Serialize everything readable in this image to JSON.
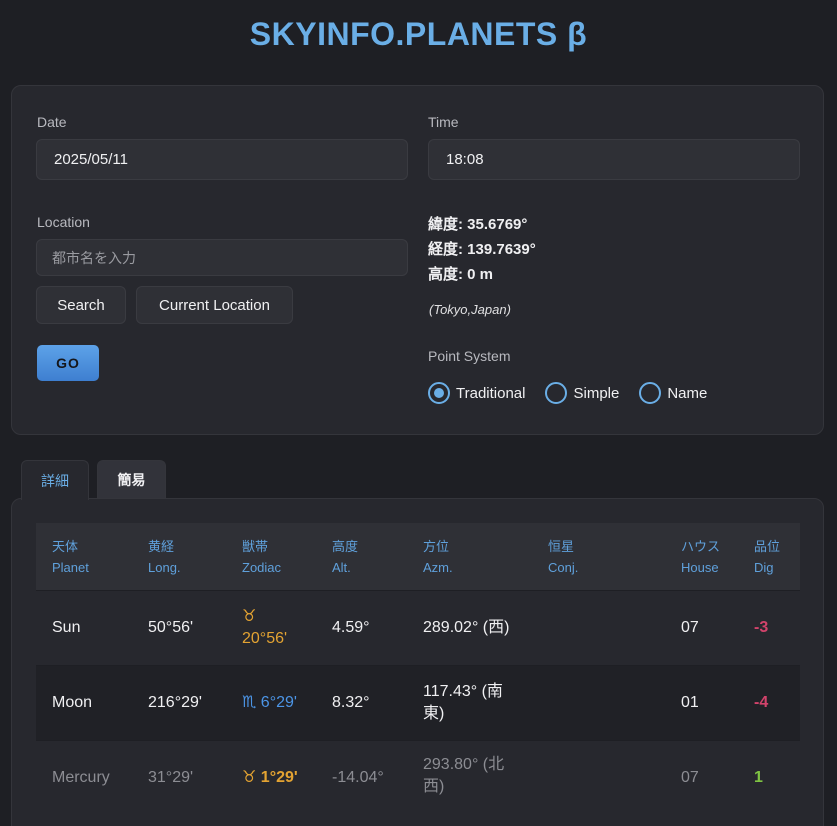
{
  "app": {
    "title": "SKYINFO.PLANETS β"
  },
  "form": {
    "date_label": "Date",
    "date_value": "2025/05/11",
    "time_label": "Time",
    "time_value": "18:08",
    "location_label": "Location",
    "location_placeholder": "都市名を入力",
    "search_label": "Search",
    "current_location_label": "Current Location",
    "go_label": "GO",
    "latitude": "緯度: 35.6769°",
    "longitude": "経度: 139.7639°",
    "altitude": "高度: 0 m",
    "place": "(Tokyo,Japan)",
    "point_system_label": "Point System",
    "point_system_options": [
      "Traditional",
      "Simple",
      "Name"
    ],
    "point_system_selected": "Traditional"
  },
  "tabs": [
    {
      "label": "詳細",
      "active": true
    },
    {
      "label": "簡易",
      "active": false
    }
  ],
  "table": {
    "headers": [
      {
        "ja": "天体",
        "en": "Planet"
      },
      {
        "ja": "黄経",
        "en": "Long."
      },
      {
        "ja": "獣帯",
        "en": "Zodiac"
      },
      {
        "ja": "高度",
        "en": "Alt."
      },
      {
        "ja": "方位",
        "en": "Azm."
      },
      {
        "ja": "恒星",
        "en": "Conj."
      },
      {
        "ja": "ハウス",
        "en": "House"
      },
      {
        "ja": "品位",
        "en": "Dig"
      }
    ],
    "rows": [
      {
        "planet": "Sun",
        "long": "50°56'",
        "zodiac_sign": "♉",
        "zodiac_deg": "20°56'",
        "alt": "4.59°",
        "azm_line1": "289.02° (西)",
        "azm_line2": "",
        "conj": "",
        "house": "07",
        "dig": "-3"
      },
      {
        "planet": "Moon",
        "long": "216°29'",
        "zodiac_sign": "♏",
        "zodiac_deg": "6°29'",
        "alt": "8.32°",
        "azm_line1": "117.43° (南",
        "azm_line2": "東)",
        "conj": "",
        "house": "01",
        "dig": "-4"
      },
      {
        "planet": "Mercury",
        "long": "31°29'",
        "zodiac_sign": "♉",
        "zodiac_deg": "1°29'",
        "alt": "-14.04°",
        "azm_line1": "293.80° (北",
        "azm_line2": "西)",
        "conj": "",
        "house": "07",
        "dig": "1"
      }
    ]
  },
  "colors": {
    "accent": "#6aaee6",
    "background": "#1e1f24",
    "panel": "#27282e",
    "zodiac_earth": "#e3a332",
    "zodiac_water": "#4c95e6",
    "dignity_negative": "#d2436b",
    "dignity_positive": "#7fc443"
  }
}
